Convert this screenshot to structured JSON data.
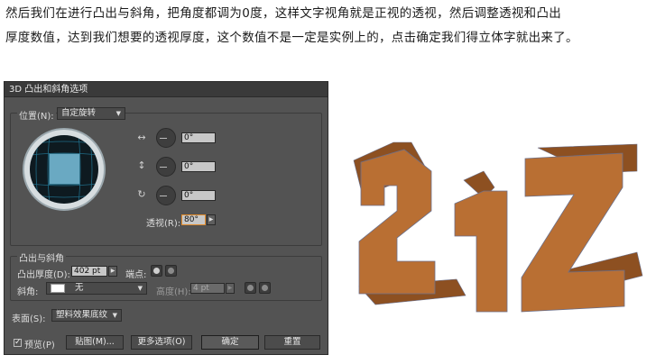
{
  "caption": {
    "line1": "然后我们在进行凸出与斜角，把角度都调为0度，这样文字视角就是正视的透视，然后调整透视和凸出",
    "line2": "厚度数值，达到我们想要的透视厚度，这个数值不是一定是实例上的，点击确定我们得立体字就出来了。"
  },
  "dialog": {
    "title": "3D 凸出和斜角选项",
    "position": {
      "label": "位置(N):",
      "value": "自定旋转",
      "x_angle": "0°",
      "y_angle": "0°",
      "z_angle": "0°",
      "perspective_label": "透视(R):",
      "perspective_value": "80°"
    },
    "extrude": {
      "group_label": "凸出与斜角",
      "depth_label": "凸出厚度(D):",
      "depth_value": "402 pt",
      "cap_label": "端点:",
      "bevel_label": "斜角:",
      "bevel_value": "无",
      "height_label": "高度(H):",
      "height_value": "4 pt"
    },
    "surface": {
      "label": "表面(S):",
      "value": "塑料效果底纹"
    },
    "footer": {
      "preview_label": "预览(P)",
      "preview_checked": true,
      "map_button": "贴图(M)...",
      "more_button": "更多选项(O)",
      "ok_button": "确定",
      "reset_button": "重置"
    }
  },
  "artwork": {
    "text": "21Z",
    "face_color": "#b96f33",
    "side_color": "#8d5021",
    "outline_color": "#6b6f8a"
  }
}
